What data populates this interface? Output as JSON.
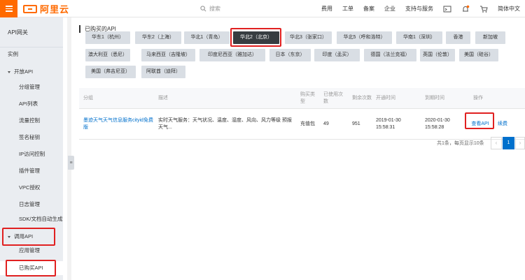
{
  "topbar": {
    "brand": "阿里云",
    "search_placeholder": "搜索",
    "nav": [
      "费用",
      "工单",
      "备案",
      "企业",
      "支持与服务"
    ],
    "language": "简体中文"
  },
  "sidebar": {
    "title": "API网关",
    "items": [
      {
        "label": "实例",
        "kind": "l1"
      },
      {
        "label": "开放API",
        "kind": "group"
      },
      {
        "label": "分组管理",
        "kind": "l2"
      },
      {
        "label": "API列表",
        "kind": "l2"
      },
      {
        "label": "流量控制",
        "kind": "l2"
      },
      {
        "label": "签名秘钥",
        "kind": "l2"
      },
      {
        "label": "IP访问控制",
        "kind": "l2"
      },
      {
        "label": "插件管理",
        "kind": "l2"
      },
      {
        "label": "VPC授权",
        "kind": "l2"
      },
      {
        "label": "日志管理",
        "kind": "l2"
      },
      {
        "label": "SDK/文档自动生成",
        "kind": "l2"
      },
      {
        "label": "调用API",
        "kind": "group"
      },
      {
        "label": "应用管理",
        "kind": "l2"
      },
      {
        "label": "已购买API",
        "kind": "l2",
        "active": true
      }
    ]
  },
  "main": {
    "section_title": "已购买的API",
    "regions": [
      "华东1（杭州）",
      "华东2（上海）",
      "华北1（青岛）",
      "华北2（北京）",
      "华北3（张家口）",
      "华北5（呼和浩特）",
      "华南1（深圳）",
      "香港",
      "新加坡",
      "澳大利亚（悉尼）",
      "马来西亚（吉隆坡）",
      "印度尼西亚（雅加达）",
      "日本（东京）",
      "印度（孟买）",
      "德国（法兰克福）",
      "英国（伦敦）",
      "美国（硅谷）",
      "美国（弗吉尼亚）",
      "阿联酋（迪拜）"
    ],
    "selected_region": "华北2（北京）",
    "table": {
      "headers": [
        "分组",
        "描述",
        "购买类型",
        "已使用次数",
        "剩余次数",
        "开通时间",
        "到期时间",
        "操作"
      ],
      "rows": [
        {
          "group": "墨迹天气天气信息服务cityid免费版",
          "description": "实时天气服务：天气状况、温度、湿度、风向、风力等级 预报天气...",
          "purchase_type": "充值包",
          "used": "49",
          "remaining": "951",
          "opened": "2019-01-30 15:58:31",
          "expires": "2020-01-30 15:58:28",
          "action_view": "查看API",
          "action_renew": "续费"
        }
      ]
    },
    "pagination": {
      "info": "共1条，每页显示10条",
      "prev": "‹",
      "current": "1",
      "next": "›"
    }
  },
  "colors": {
    "brand": "#ff6a00",
    "link": "#0070cc",
    "highlight": "#e02020",
    "selected_region": "#373d41"
  }
}
